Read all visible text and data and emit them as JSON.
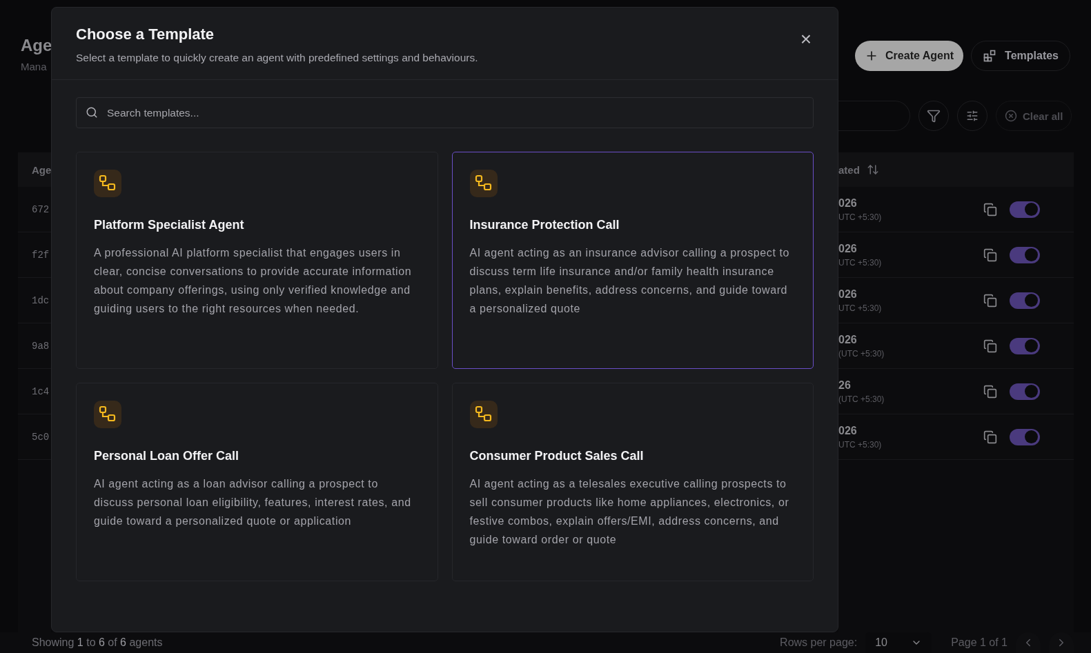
{
  "page": {
    "title": "Age",
    "subtitle": "Mana",
    "create_button": "Create Agent",
    "templates_button": "Templates",
    "clear_all": "Clear all"
  },
  "table": {
    "column_1": "Age",
    "column_2": "ated",
    "rows": [
      {
        "id": "672",
        "date": "026",
        "time": "UTC +5:30)",
        "enabled": true
      },
      {
        "id": "f2f",
        "date": "026",
        "time": "UTC +5:30)",
        "enabled": true
      },
      {
        "id": "1dc",
        "date": "026",
        "time": "UTC +5:30)",
        "enabled": true
      },
      {
        "id": "9a8",
        "date": "026",
        "time": "(UTC +5:30)",
        "enabled": true
      },
      {
        "id": "1c4",
        "date": "26",
        "time": "(UTC +5:30)",
        "enabled": true
      },
      {
        "id": "5c0",
        "date": "026",
        "time": "UTC +5:30)",
        "enabled": true
      }
    ]
  },
  "footer": {
    "summary": "Showing **1** to **6** of **6** agents",
    "rows_per_page_label": "Rows per page:",
    "rows_per_page": "10",
    "page": "Page 1 of 1"
  },
  "dialog": {
    "title": "Choose a Template",
    "subtitle": "Select a template to quickly create an agent with predefined settings and behaviours.",
    "close": "×",
    "search": {
      "placeholder": "Search templates..."
    },
    "templates": [
      {
        "title": "Platform Specialist Agent",
        "description": "A professional AI platform specialist that engages users in clear, concise conversations to provide accurate information about company offerings, using only verified knowledge and guiding users to the right resources when needed.",
        "selected": false
      },
      {
        "title": "Insurance Protection Call",
        "description": "AI agent acting as an insurance advisor calling a prospect to discuss term life insurance and/or family health insurance plans, explain benefits, address concerns, and guide toward a personalized quote",
        "selected": true
      },
      {
        "title": "Personal Loan Offer Call",
        "description": "AI agent acting as a loan advisor calling a prospect to discuss personal loan eligibility, features, interest rates, and guide toward a personalized quote or application",
        "selected": false
      },
      {
        "title": "Consumer Product Sales Call",
        "description": "AI agent acting as a telesales executive calling prospects to sell consumer products like home appliances, electronics, or festive combos, explain offers/EMI, address concerns, and guide toward order or quote",
        "selected": false
      }
    ]
  }
}
